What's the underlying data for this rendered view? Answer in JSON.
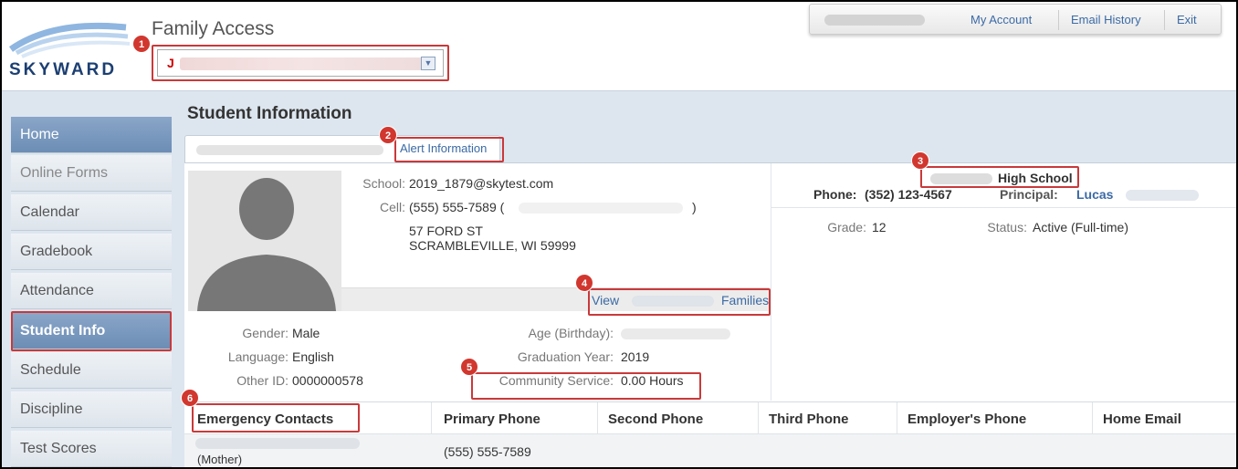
{
  "header": {
    "app_title": "Family Access",
    "logo_text": "SKYWARD",
    "student_select_initial": "J",
    "links": {
      "my_account": "My Account",
      "email_history": "Email History",
      "exit": "Exit"
    }
  },
  "sidebar": {
    "items": [
      {
        "label": "Home"
      },
      {
        "label": "Online Forms"
      },
      {
        "label": "Calendar"
      },
      {
        "label": "Gradebook"
      },
      {
        "label": "Attendance"
      },
      {
        "label": "Student Info"
      },
      {
        "label": "Schedule"
      },
      {
        "label": "Discipline"
      },
      {
        "label": "Test Scores"
      }
    ]
  },
  "main": {
    "title": "Student Information",
    "tab_link": "Alert Information",
    "school_label": "School:",
    "school_email": "2019_1879@skytest.com",
    "cell_label": "Cell:",
    "cell_value": "(555) 555-7589 (",
    "cell_close": ")",
    "address_line1": "57 FORD ST",
    "address_line2": "SCRAMBLEVILLE, WI 59999",
    "view_link": "View",
    "families_link": "Families",
    "gender_label": "Gender:",
    "gender": "Male",
    "language_label": "Language:",
    "language": "English",
    "other_id_label": "Other ID:",
    "other_id": "0000000578",
    "age_label": "Age (Birthday):",
    "grad_year_label": "Graduation Year:",
    "grad_year": "2019",
    "community_label": "Community Service:",
    "community_value": "0.00 Hours",
    "school_name": "High School",
    "phone_label": "Phone:",
    "phone": "(352) 123-4567",
    "principal_label": "Principal:",
    "principal": "Lucas",
    "grade_label": "Grade:",
    "grade": "12",
    "status_label": "Status:",
    "status": "Active (Full-time)"
  },
  "contacts": {
    "headers": [
      "Emergency Contacts",
      "Primary Phone",
      "Second Phone",
      "Third Phone",
      "Employer's Phone",
      "Home Email"
    ],
    "rows": [
      {
        "relation": "(Mother)",
        "primary_phone": "(555) 555-7589"
      }
    ]
  },
  "callouts": [
    "1",
    "2",
    "3",
    "4",
    "5",
    "6"
  ],
  "colors": {
    "accent": "#3b6aa5",
    "callout": "#c9393a",
    "sidebar_active": "#6c8db5",
    "background": "#dde6ef"
  }
}
